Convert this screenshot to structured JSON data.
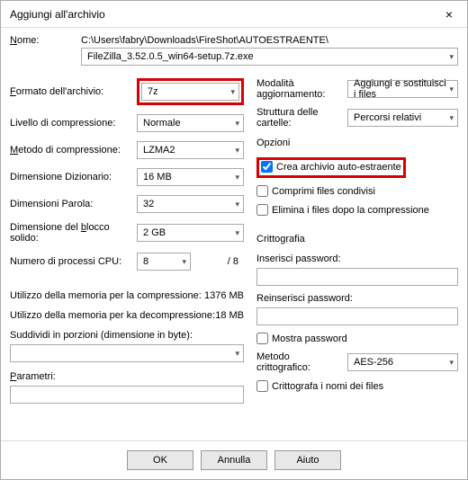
{
  "title": "Aggiungi all'archivio",
  "close_glyph": "×",
  "name_label": "Nome:",
  "path": "C:\\Users\\fabry\\Downloads\\FireShot\\AUTOESTRAENTE\\",
  "filename": "FileZilla_3.52.0.5_win64-setup.7z.exe",
  "left": {
    "format_label": "Formato dell'archivio:",
    "format_value": "7z",
    "level_label": "Livello di compressione:",
    "level_value": "Normale",
    "method_label": "Metodo di compressione:",
    "method_value": "LZMA2",
    "dict_label": "Dimensione Dizionario:",
    "dict_value": "16 MB",
    "word_label": "Dimensioni Parola:",
    "word_value": "32",
    "block_label": "Dimensione del blocco solido:",
    "block_value": "2 GB",
    "cpu_label": "Numero di processi CPU:",
    "cpu_value": "8",
    "cpu_total": "/ 8",
    "mem_comp_label": "Utilizzo della memoria per la compressione:",
    "mem_comp_value": "1376 MB",
    "mem_decomp_label": "Utilizzo della memoria per ka decompressione:",
    "mem_decomp_value": "18 MB",
    "split_label": "Suddividi in porzioni (dimensione in byte):",
    "split_value": "",
    "params_label": "Parametri:",
    "params_value": ""
  },
  "right": {
    "update_label": "Modalità aggiornamento:",
    "update_value": "Aggiungi e sostituisci i files",
    "struct_label": "Struttura delle cartelle:",
    "struct_value": "Percorsi relativi",
    "options_title": "Opzioni",
    "sfx_label": "Crea archivio auto-estraente",
    "shared_label": "Comprimi files condivisi",
    "delete_label": "Elimina i files dopo la compressione",
    "crypto_title": "Crittografia",
    "pw_label": "Inserisci password:",
    "pw_value": "",
    "pw2_label": "Reinserisci password:",
    "pw2_value": "",
    "show_pw_label": "Mostra password",
    "crypto_method_label": "Metodo crittografico:",
    "crypto_method_value": "AES-256",
    "encrypt_names_label": "Crittografa i nomi dei files"
  },
  "buttons": {
    "ok": "OK",
    "cancel": "Annulla",
    "help": "Aiuto"
  }
}
